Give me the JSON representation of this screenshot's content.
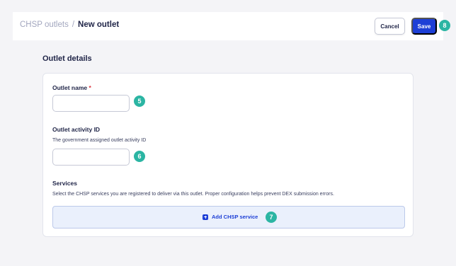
{
  "breadcrumb": {
    "root": "CHSP outlets",
    "separator": "/",
    "current": "New outlet"
  },
  "actions": {
    "cancel_label": "Cancel",
    "save_label": "Save"
  },
  "section": {
    "title": "Outlet details"
  },
  "form": {
    "outlet_name": {
      "label": "Outlet name",
      "required_marker": "*",
      "value": "",
      "placeholder": ""
    },
    "activity_id": {
      "label": "Outlet activity ID",
      "help": "The government assigned outlet activity ID",
      "value": "",
      "placeholder": ""
    },
    "services": {
      "label": "Services",
      "help": "Select the CHSP services you are registered to deliver via this outlet. Proper configuration helps prevent DEX submission errors.",
      "add_label": "Add CHSP service",
      "add_icon": "plus-square-icon"
    }
  },
  "step_badges": {
    "outlet_name": "5",
    "activity_id": "6",
    "add_service": "7",
    "save": "8"
  },
  "colors": {
    "primary": "#1d3fd6",
    "badge": "#2bb5a3",
    "required": "#d9323b"
  }
}
